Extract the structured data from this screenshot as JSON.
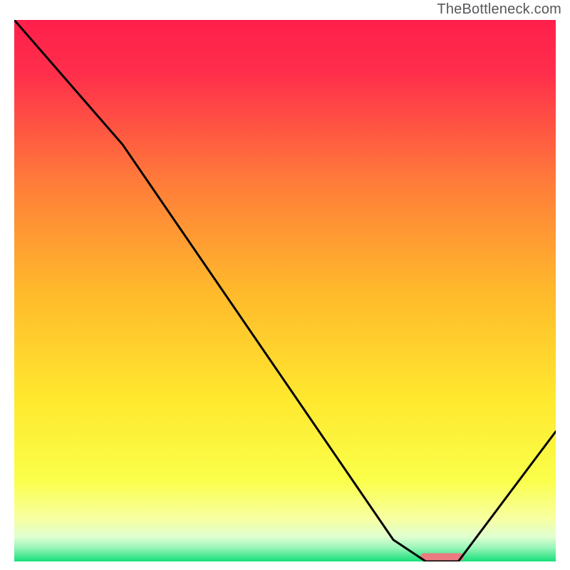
{
  "watermark": "TheBottleneck.com",
  "chart_data": {
    "type": "line",
    "title": "",
    "xlabel": "",
    "ylabel": "",
    "xlim": [
      0,
      100
    ],
    "ylim": [
      0,
      100
    ],
    "grid": false,
    "legend": false,
    "series": [
      {
        "name": "bottleneck-curve",
        "x": [
          0,
          20,
          70,
          76,
          82,
          100
        ],
        "y": [
          100,
          77,
          4,
          0,
          0,
          24
        ]
      }
    ],
    "marker": {
      "name": "optimal-range",
      "x_center": 79,
      "width": 8,
      "y": 0.8,
      "color": "#ea7b80"
    },
    "background": {
      "type": "vertical-gradient",
      "stops": [
        {
          "pos": 0.0,
          "color": "#ff1f4b"
        },
        {
          "pos": 0.1,
          "color": "#ff2f4b"
        },
        {
          "pos": 0.3,
          "color": "#ff7c3a"
        },
        {
          "pos": 0.5,
          "color": "#ffb92c"
        },
        {
          "pos": 0.7,
          "color": "#ffe82e"
        },
        {
          "pos": 0.85,
          "color": "#faff4a"
        },
        {
          "pos": 0.92,
          "color": "#f8ffa0"
        },
        {
          "pos": 0.955,
          "color": "#dfffd0"
        },
        {
          "pos": 0.975,
          "color": "#97f5b8"
        },
        {
          "pos": 1.0,
          "color": "#17e07a"
        }
      ]
    }
  }
}
